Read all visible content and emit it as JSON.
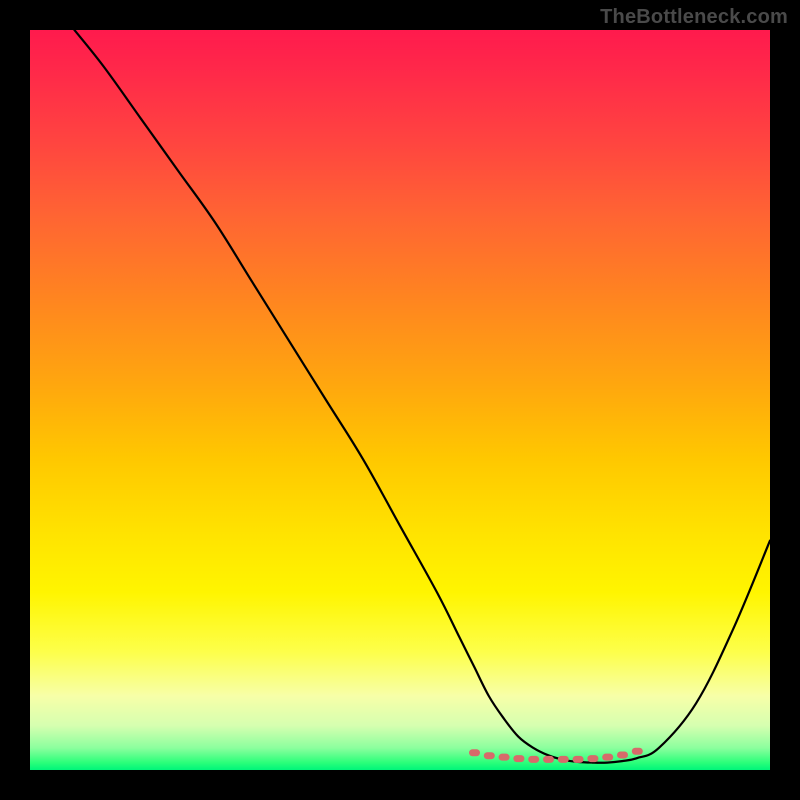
{
  "watermark": "TheBottleneck.com",
  "chart_data": {
    "type": "line",
    "title": "",
    "xlabel": "",
    "ylabel": "",
    "xlim": [
      0,
      100
    ],
    "ylim": [
      0,
      100
    ],
    "series": [
      {
        "name": "curve",
        "x": [
          6,
          10,
          15,
          20,
          25,
          30,
          35,
          40,
          45,
          50,
          55,
          58,
          60,
          62,
          64,
          66,
          68,
          70,
          72,
          74,
          76,
          78,
          80,
          82,
          85,
          90,
          95,
          100
        ],
        "y": [
          100,
          95,
          88,
          81,
          74,
          66,
          58,
          50,
          42,
          33,
          24,
          18,
          14,
          10,
          7,
          4.5,
          3,
          2,
          1.4,
          1.1,
          1,
          1,
          1.2,
          1.6,
          3,
          9,
          19,
          31
        ]
      },
      {
        "name": "highlight-dots",
        "x": [
          60,
          62,
          64,
          66,
          68,
          70,
          72,
          74,
          76,
          78,
          80,
          82
        ],
        "y": [
          2.4,
          2.0,
          1.8,
          1.6,
          1.5,
          1.5,
          1.5,
          1.5,
          1.6,
          1.8,
          2.1,
          2.6
        ]
      }
    ],
    "gradient_stops": [
      {
        "pos": 0.0,
        "color": "#ff1a4d"
      },
      {
        "pos": 0.5,
        "color": "#ffb400"
      },
      {
        "pos": 0.8,
        "color": "#fff500"
      },
      {
        "pos": 1.0,
        "color": "#00f57a"
      }
    ],
    "annotations": []
  }
}
